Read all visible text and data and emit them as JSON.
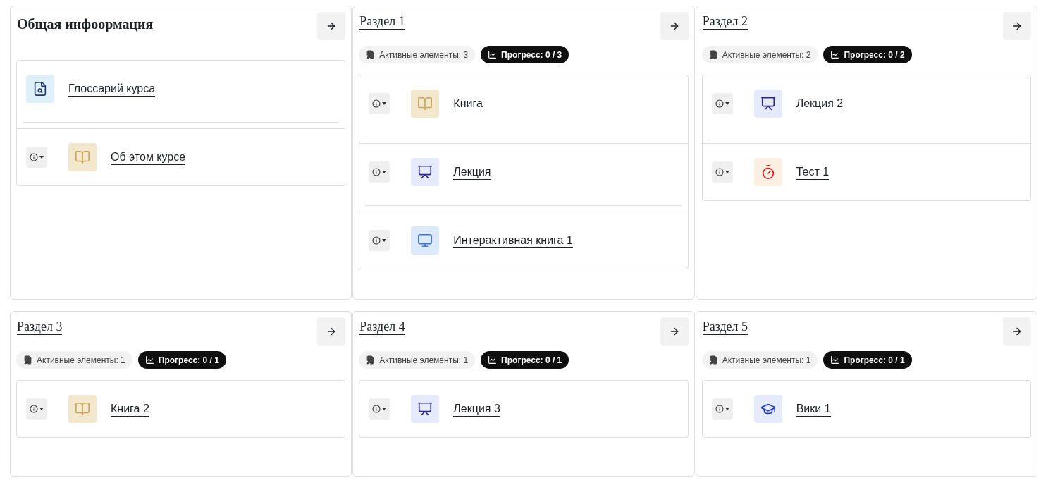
{
  "sections": [
    {
      "kind": "general",
      "title": "Общая инфоормация",
      "items": [
        {
          "kind": "glossary",
          "title": "Глоссарий курса",
          "has_menu": false
        },
        {
          "kind": "book",
          "title": "Об этом курсе",
          "has_menu": true
        }
      ]
    },
    {
      "kind": "topic",
      "title": "Раздел 1",
      "active": "Активные элементы: 3",
      "progress": "Прогресс: 0 / 3",
      "items": [
        {
          "kind": "book",
          "title": "Книга",
          "has_menu": true
        },
        {
          "kind": "lecture",
          "title": "Лекция",
          "has_menu": true
        },
        {
          "kind": "interactive",
          "title": "Интерактивная книга 1",
          "has_menu": true
        }
      ]
    },
    {
      "kind": "topic",
      "title": "Раздел 2",
      "active": "Активные элементы: 2",
      "progress": "Прогресс: 0 / 2",
      "items": [
        {
          "kind": "lecture",
          "title": "Лекция 2",
          "has_menu": true
        },
        {
          "kind": "quiz",
          "title": "Тест 1",
          "has_menu": true
        }
      ]
    },
    {
      "kind": "topic",
      "title": "Раздел 3",
      "active": "Активные элементы: 1",
      "progress": "Прогресс: 0 / 1",
      "items": [
        {
          "kind": "book",
          "title": "Книга 2",
          "has_menu": true
        }
      ]
    },
    {
      "kind": "topic",
      "title": "Раздел 4",
      "active": "Активные элементы: 1",
      "progress": "Прогресс: 0 / 1",
      "items": [
        {
          "kind": "lecture",
          "title": "Лекция 3",
          "has_menu": true
        }
      ]
    },
    {
      "kind": "topic",
      "title": "Раздел 5",
      "active": "Активные элементы: 1",
      "progress": "Прогресс: 0 / 1",
      "items": [
        {
          "kind": "wiki",
          "title": "Вики 1",
          "has_menu": true
        }
      ]
    }
  ]
}
